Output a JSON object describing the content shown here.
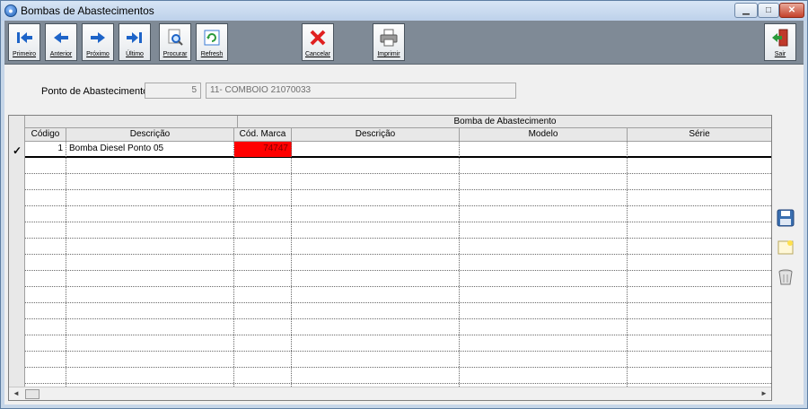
{
  "window": {
    "title": "Bombas de Abastecimentos"
  },
  "toolbar": {
    "primeiro": "Primeiro",
    "anterior": "Anterior",
    "proximo": "Próximo",
    "ultimo": "Último",
    "procurar": "Procurar",
    "refresh": "Refresh",
    "cancelar": "Cancelar",
    "imprimir": "Imprimir",
    "sair": "Sair"
  },
  "form": {
    "ponto_label": "Ponto de Abastecimento:",
    "ponto_codigo": "5",
    "ponto_descricao": "11- COMBOIO 21070033"
  },
  "grid": {
    "group_header": "Bomba de Abastecimento",
    "columns": [
      "Código",
      "Descrição",
      "Cód. Marca",
      "Descrição",
      "Modelo",
      "Série"
    ],
    "rows": [
      {
        "codigo": "1",
        "descricao": "Bomba Diesel Ponto 05",
        "cod_marca": "74747",
        "marca_descricao": "",
        "modelo": "",
        "serie": ""
      }
    ]
  },
  "colors": {
    "toolbar": "#7f8a96",
    "highlight_cell": "#ff0000",
    "window_frame": "#c6d6e8"
  }
}
